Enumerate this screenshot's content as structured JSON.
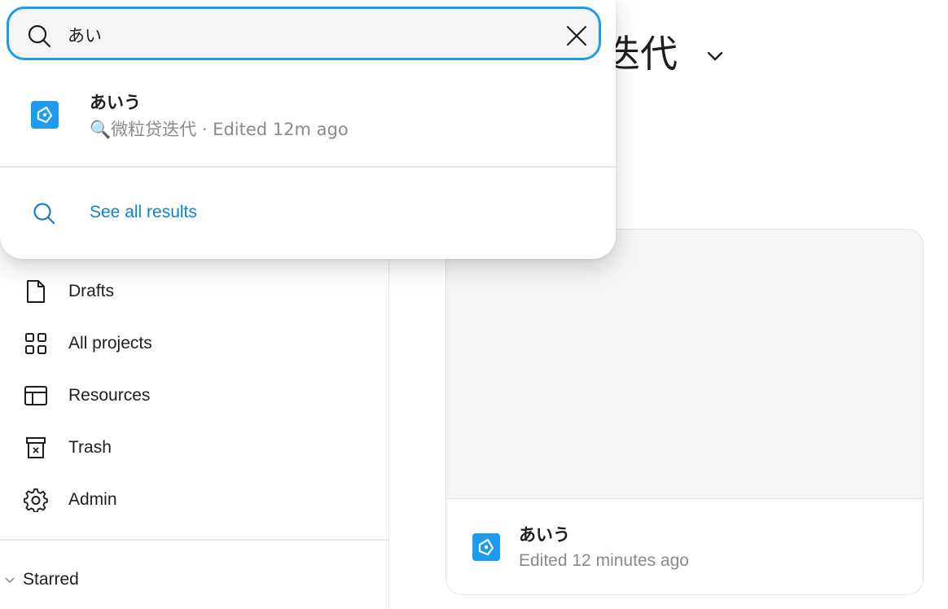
{
  "search": {
    "query": "あい",
    "results": [
      {
        "name": "あいう",
        "meta": "🔍微粒贷迭代 · Edited 12m ago"
      }
    ],
    "see_all_label": "See all results"
  },
  "sidebar": {
    "items": [
      {
        "label": "Drafts",
        "icon": "file-icon"
      },
      {
        "label": "All projects",
        "icon": "grid-icon"
      },
      {
        "label": "Resources",
        "icon": "layout-icon"
      },
      {
        "label": "Trash",
        "icon": "trash-icon"
      },
      {
        "label": "Admin",
        "icon": "gear-icon"
      }
    ],
    "starred_label": "Starred"
  },
  "main": {
    "title_visible": "迭代",
    "card": {
      "name": "あいう",
      "meta": "Edited 12 minutes ago"
    }
  },
  "colors": {
    "accent": "#1e9bf0",
    "link": "#1381c7",
    "file_icon": "#1d9bf0"
  }
}
